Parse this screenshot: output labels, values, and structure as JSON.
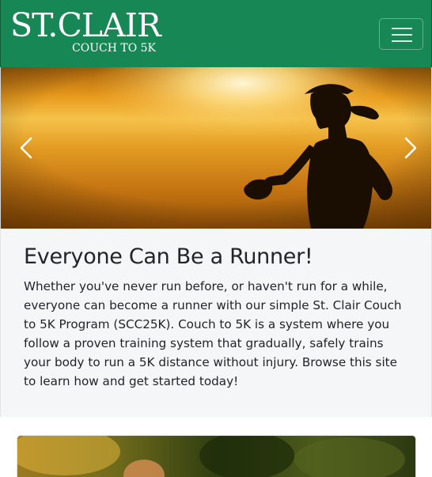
{
  "navbar": {
    "brand_main": "ST.CLAIR",
    "brand_sub": "COUCH TO 5K",
    "toggle_label": "Toggle navigation",
    "color": "#178755"
  },
  "hero": {
    "prev_label": "Previous",
    "next_label": "Next",
    "image_alt": "Silhouette of a woman running at sunset"
  },
  "intro": {
    "heading": "Everyone Can Be a Runner!",
    "body": "Whether you've never run before, or haven't run for a while, everyone can become a runner with our simple St. Clair Couch to 5K Program (SCC25K). Couch to 5K is a system where you follow a proven training system that gradually, safely trains your body to run a 5K distance without injury. Browse this site to learn how and get started today!"
  },
  "card": {
    "image_alt": "Runner in a park"
  }
}
